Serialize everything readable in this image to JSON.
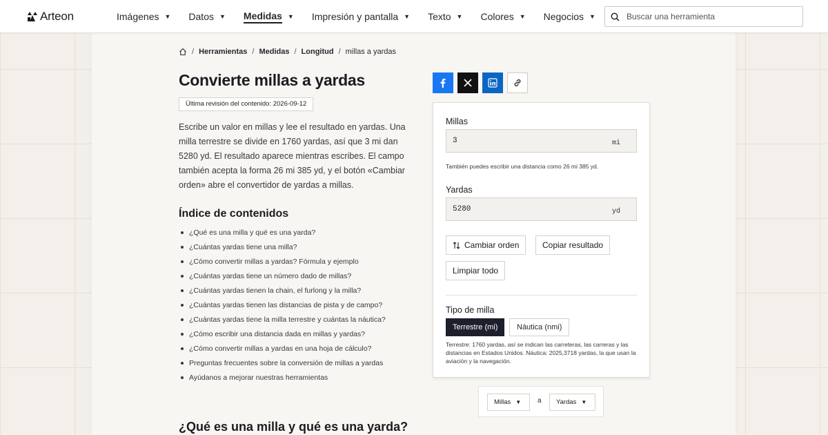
{
  "header": {
    "logo_text": "Arteon",
    "nav": [
      {
        "label": "Imágenes"
      },
      {
        "label": "Datos"
      },
      {
        "label": "Medidas",
        "active": true
      },
      {
        "label": "Impresión y pantalla"
      },
      {
        "label": "Texto"
      },
      {
        "label": "Colores"
      },
      {
        "label": "Negocios"
      }
    ],
    "search_placeholder": "Buscar una herramienta"
  },
  "breadcrumb": [
    "Herramientas",
    "Medidas",
    "Longitud",
    "millas a yardas"
  ],
  "page": {
    "title": "Convierte millas a yardas",
    "revision": "Última revisión del contenido: 2026-09-12",
    "intro": "Escribe un valor en millas y lee el resultado en yardas. Una milla terrestre se divide en 1760 yardas, así que 3 mi dan 5280 yd. El resultado aparece mientras escribes. El campo también acepta la forma 26 mi 385 yd, y el botón «Cambiar orden» abre el convertidor de yardas a millas.",
    "toc_title": "Índice de contenidos",
    "toc": [
      "¿Qué es una milla y qué es una yarda?",
      "¿Cuántas yardas tiene una milla?",
      "¿Cómo convertir millas a yardas? Fórmula y ejemplo",
      "¿Cuántas yardas tiene un número dado de millas?",
      "¿Cuántas yardas tienen la chain, el furlong y la milla?",
      "¿Cuántas yardas tienen las distancias de pista y de campo?",
      "¿Cuántas yardas tiene la milla terrestre y cuántas la náutica?",
      "¿Cómo escribir una distancia dada en millas y yardas?",
      "¿Cómo convertir millas a yardas en una hoja de cálculo?",
      "Preguntas frecuentes sobre la conversión de millas a yardas",
      "Ayúdanos a mejorar nuestras herramientas"
    ],
    "section_heading": "¿Qué es una milla y qué es una yarda?"
  },
  "share": [
    "facebook-icon",
    "x-icon",
    "linkedin-icon",
    "link-icon"
  ],
  "converter": {
    "from_label": "Millas",
    "from_value": "3",
    "from_unit": "mi",
    "hint": "También puedes escribir una distancia como 26 mi 385 yd.",
    "to_label": "Yardas",
    "to_value": "5280",
    "to_unit": "yd",
    "swap_label": "Cambiar orden",
    "copy_label": "Copiar resultado",
    "clear_label": "Limpiar todo",
    "mile_type_label": "Tipo de milla",
    "mile_type_options": [
      "Terrestre (mi)",
      "Náutica (nmi)"
    ],
    "mile_type_selected": "Terrestre (mi)",
    "note": "Terrestre: 1760 yardas, así se indican las carreteras, las carreras y las distancias en Estados Unidos. Náutica: 2025,3718 yardas, la que usan la aviación y la navegación."
  },
  "unit_selectors": {
    "from": "Millas",
    "connector": "a",
    "to": "Yardas"
  },
  "colors": {
    "accent_dark": "#1d1f2c",
    "facebook": "#1877f2",
    "linkedin": "#0a66c2"
  }
}
